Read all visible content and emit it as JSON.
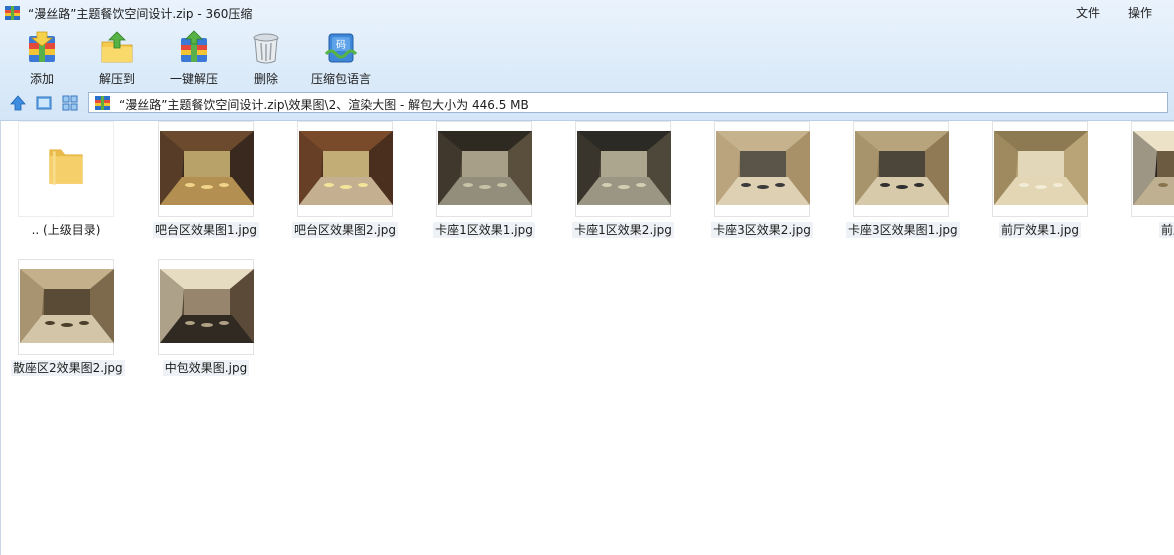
{
  "window": {
    "title": "“漫丝路”主题餐饮空间设计.zip - 360压缩",
    "menus": [
      "文件",
      "操作"
    ]
  },
  "toolbar": {
    "add": "添加",
    "extract_to": "解压到",
    "one_key_extract": "一键解压",
    "delete": "删除",
    "archive_language": "压缩包语言"
  },
  "address": {
    "path": "“漫丝路”主题餐饮空间设计.zip\\效果图\\2、渲染大图 - 解包大小为 446.5 MB"
  },
  "files": [
    {
      "name": ".. (上级目录)",
      "type": "folder"
    },
    {
      "name": "吧台区效果图1.jpg",
      "type": "image",
      "palette": [
        "#3a2a1e",
        "#c9a25a",
        "#f0d48a",
        "#6b4a2e"
      ]
    },
    {
      "name": "吧台区效果图2.jpg",
      "type": "image",
      "palette": [
        "#4a2f1f",
        "#d9c6a4",
        "#f4e39a",
        "#7a4b2b"
      ]
    },
    {
      "name": "卡座1区效果1.jpg",
      "type": "image",
      "palette": [
        "#5a4e3c",
        "#9d9a86",
        "#c8c2a6",
        "#2e2a22"
      ]
    },
    {
      "name": "卡座1区效果2.jpg",
      "type": "image",
      "palette": [
        "#4f483a",
        "#a7a491",
        "#d4cfb3",
        "#2c2a24"
      ]
    },
    {
      "name": "卡座3区效果2.jpg",
      "type": "image",
      "palette": [
        "#a8906a",
        "#e8dcc0",
        "#3a3a3a",
        "#c6b28c"
      ]
    },
    {
      "name": "卡座3区效果图1.jpg",
      "type": "image",
      "palette": [
        "#8f7a56",
        "#e4d8b8",
        "#2f2f2f",
        "#b8a47c"
      ]
    },
    {
      "name": "前厅效果1.jpg",
      "type": "image",
      "palette": [
        "#b9a477",
        "#e9dfc0",
        "#f3ecd6",
        "#8e7a52"
      ]
    },
    {
      "name": "前厅效",
      "type": "image",
      "palette": [
        "#2a2420",
        "#d8c9a6",
        "#8a7450",
        "#ece2c8"
      ]
    },
    {
      "name": "散座区2效果图2.jpg",
      "type": "image",
      "palette": [
        "#7d6a4c",
        "#e2d6b8",
        "#4a3e2c",
        "#c4b08a"
      ]
    },
    {
      "name": "中包效果图.jpg",
      "type": "image",
      "palette": [
        "#5a4a38",
        "#2a2420",
        "#b0a084",
        "#e6dcc2"
      ]
    }
  ],
  "colors": {
    "chrome_top": "#eaf3fc",
    "chrome_bottom": "#d3e5f7",
    "folder": "#f5cf6a",
    "label_bg": "#eef2f6"
  }
}
